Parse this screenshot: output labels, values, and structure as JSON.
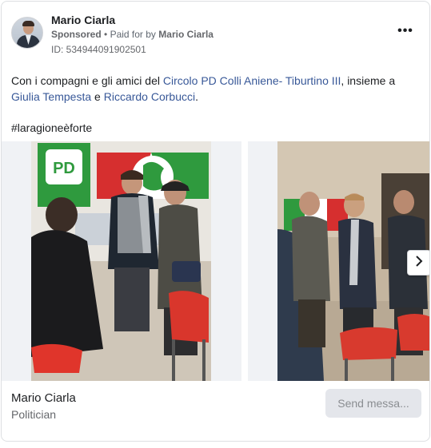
{
  "ad": {
    "advertiser_name": "Mario Ciarla",
    "sponsored_label": "Sponsored",
    "separator": "•",
    "paid_for_label": "Paid for by",
    "paid_for_name": "Mario Ciarla",
    "ad_id": "ID: 534944091902501",
    "more_label": "•••"
  },
  "post": {
    "text_part1": "Con i compagni e gli amici del ",
    "link_circolo": "Circolo PD Colli Aniene- Tiburtino III",
    "text_part2": ", insieme a ",
    "link_giulia": "Giulia Tempesta",
    "text_part3": " e ",
    "link_riccardo": "Riccardo Corbucci",
    "text_part4": ".",
    "hashtag": "#laragioneèforte"
  },
  "carousel": {
    "slides": [
      {
        "badge_text": "PD"
      },
      {
        "badge_text": ""
      }
    ],
    "next_icon": "chevron-right-icon"
  },
  "footer": {
    "page_name": "Mario Ciarla",
    "page_category": "Politician",
    "send_button": "Send messa..."
  },
  "colors": {
    "link": "#385898",
    "secondary_text": "#65676b",
    "button_bg": "#e4e6eb"
  }
}
